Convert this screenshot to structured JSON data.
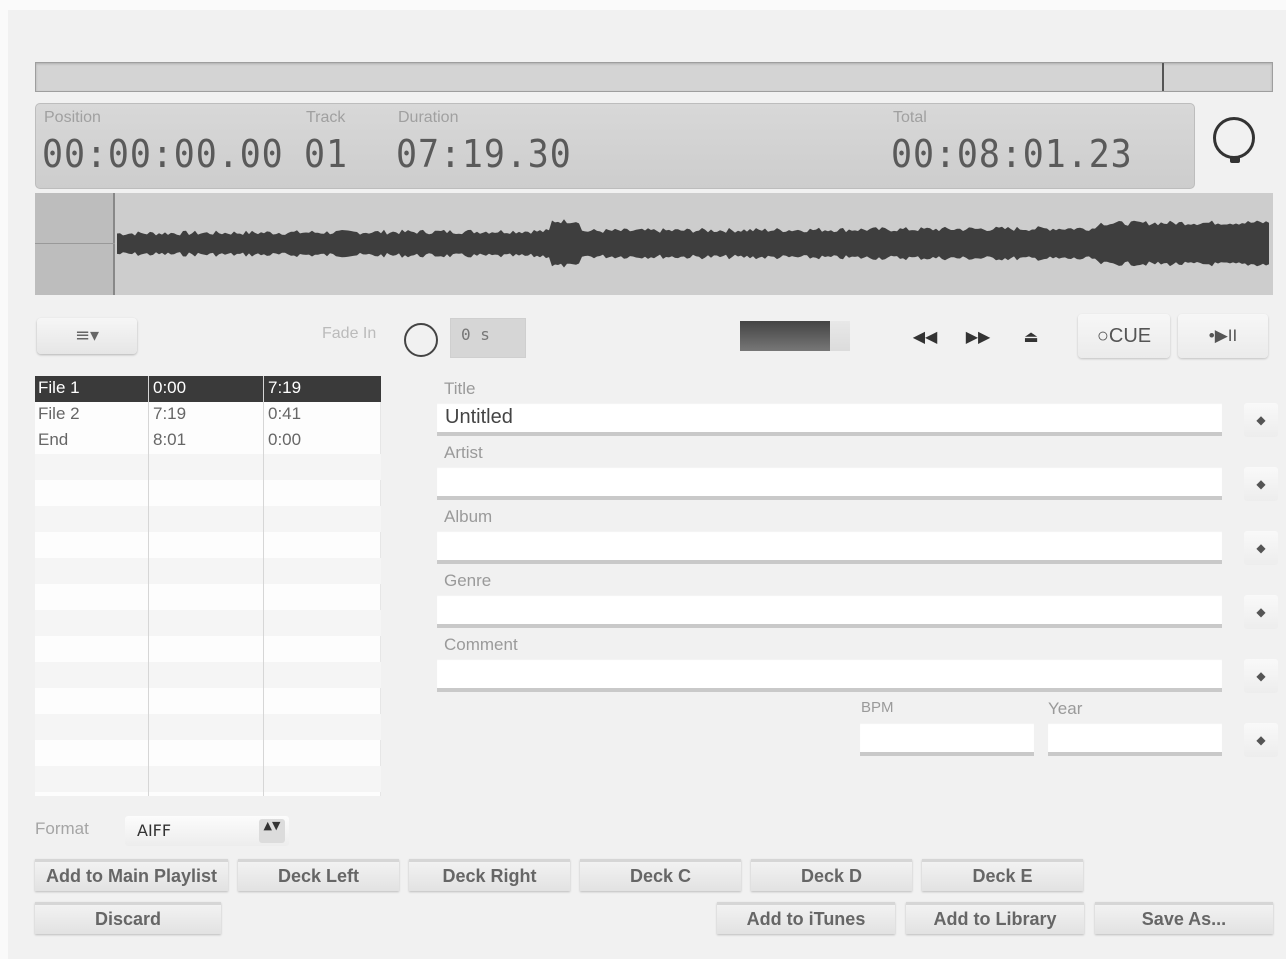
{
  "display": {
    "position_label": "Position",
    "position_value": "00:00:00.00",
    "track_label": "Track",
    "track_value": "01",
    "duration_label": "Duration",
    "duration_value": "07:19.30",
    "total_label": "Total",
    "total_value": "00:08:01.23"
  },
  "controls": {
    "menu_icon": "list-menu-icon",
    "menu_label": "≡▾",
    "fade_in_label": "Fade In",
    "fade_in_value": "0 s",
    "rewind_label": "◀◀",
    "forward_label": "▶▶",
    "eject_label": "⏏",
    "cue_label": "○CUE",
    "play_pause_label": "•▶II"
  },
  "file_list": {
    "rows": [
      {
        "name": "File 1",
        "start": "0:00",
        "length": "7:19",
        "selected": true
      },
      {
        "name": "File 2",
        "start": "7:19",
        "length": "0:41",
        "selected": false
      },
      {
        "name": "End",
        "start": "8:01",
        "length": "0:00",
        "selected": false
      }
    ]
  },
  "metadata": {
    "title_label": "Title",
    "title_value": "Untitled",
    "artist_label": "Artist",
    "artist_value": "",
    "album_label": "Album",
    "album_value": "",
    "genre_label": "Genre",
    "genre_value": "",
    "comment_label": "Comment",
    "comment_value": "",
    "bpm_label": "BPM",
    "bpm_value": "",
    "year_label": "Year",
    "year_value": "",
    "apply_arrow": "◆"
  },
  "format": {
    "label": "Format",
    "selected": "AIFF",
    "stepper": "▲▼"
  },
  "buttons": {
    "add_to_main_playlist": "Add to Main Playlist",
    "deck_left": "Deck Left",
    "deck_right": "Deck Right",
    "deck_c": "Deck C",
    "deck_d": "Deck D",
    "deck_e": "Deck E",
    "discard": "Discard",
    "add_to_itunes": "Add to iTunes",
    "add_to_library": "Add to Library",
    "save_as": "Save As..."
  },
  "playback": {
    "position_fraction": 0.911,
    "level_fraction": 0.82
  },
  "colors": {
    "background": "#f1f1f1",
    "lcd": "#d2d2d2",
    "waveform": "#3e3e3e",
    "selection": "#3a3a3a"
  }
}
